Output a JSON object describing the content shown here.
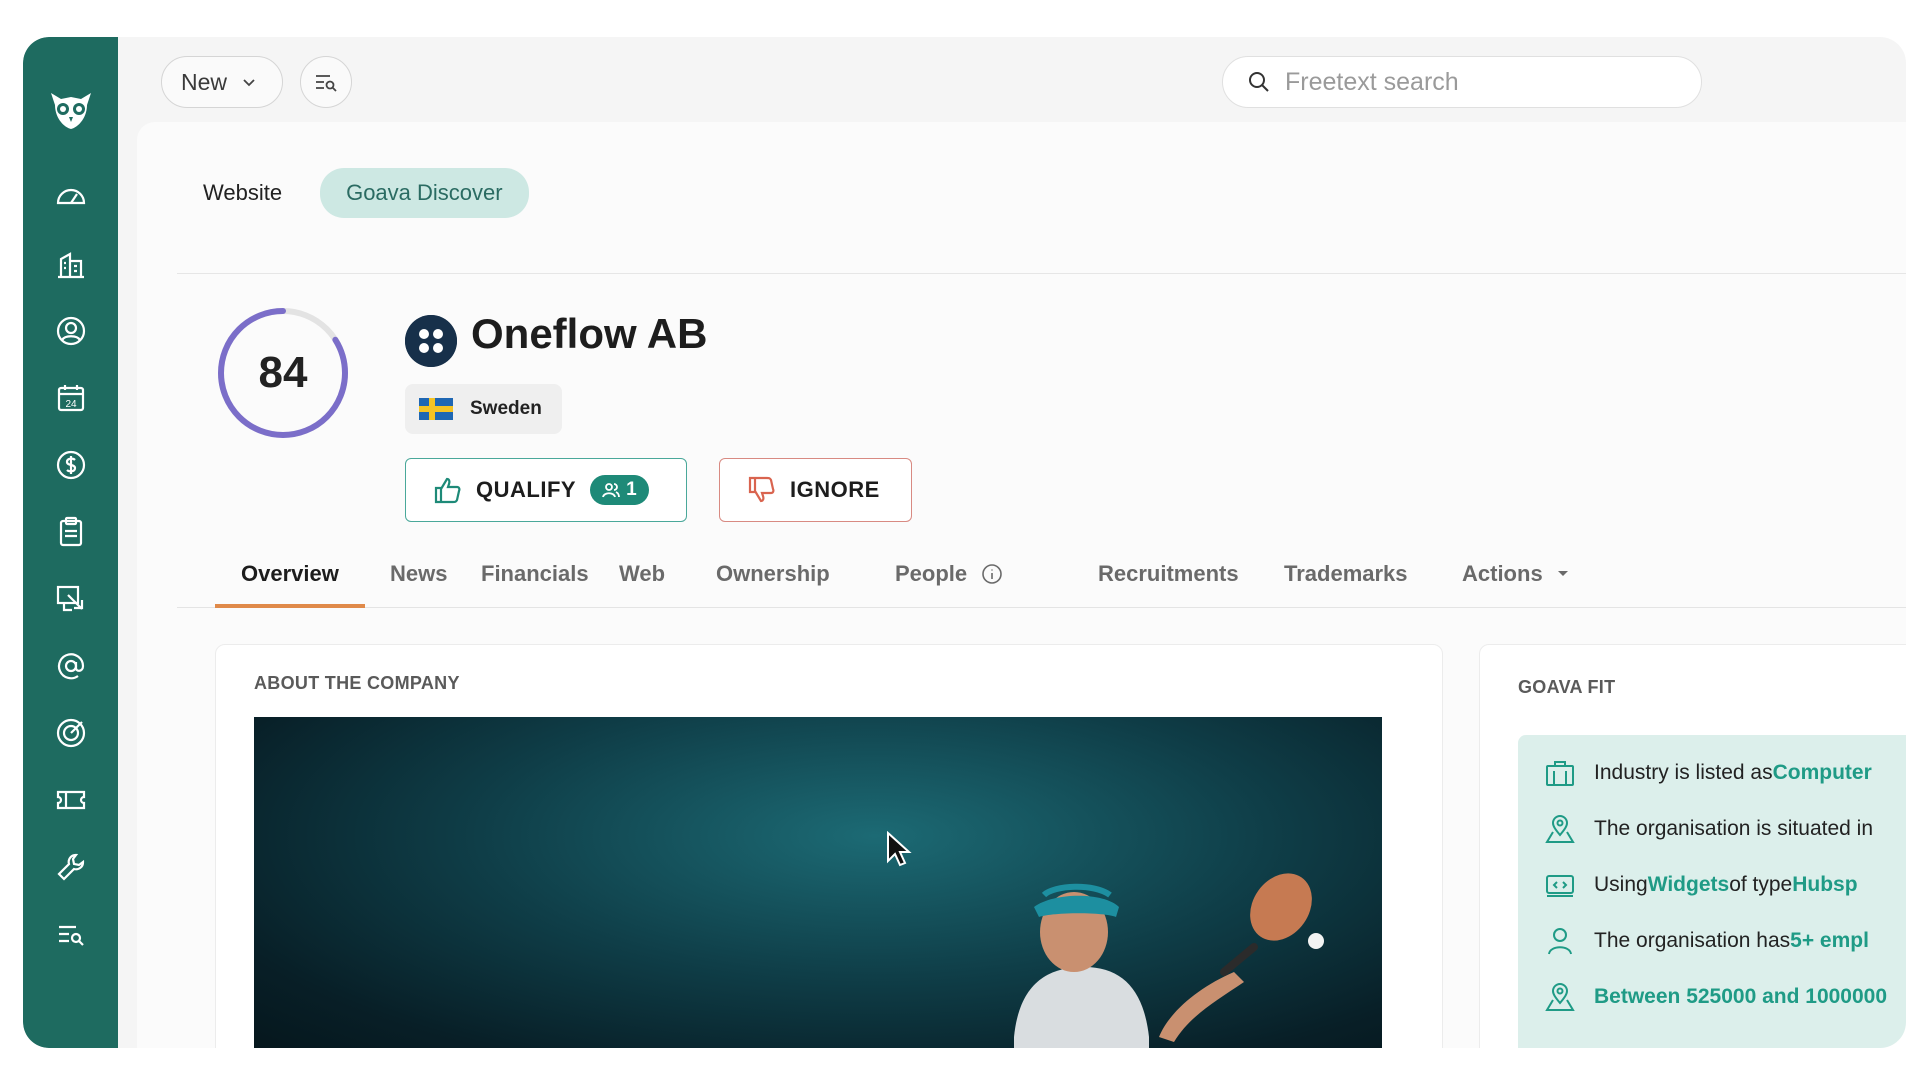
{
  "topbar": {
    "new_label": "New",
    "search_placeholder": "Freetext search"
  },
  "sidebar": {
    "items": [
      "dashboard",
      "companies",
      "contacts",
      "calendar",
      "deals",
      "tasks",
      "documents",
      "email",
      "goals",
      "tickets",
      "tools",
      "filters"
    ]
  },
  "source_tabs": {
    "website": "Website",
    "goava": "Goava Discover"
  },
  "company": {
    "score": "84",
    "score_fraction": 0.84,
    "name": "Oneflow AB",
    "country": "Sweden"
  },
  "actions": {
    "qualify_label": "QUALIFY",
    "qualify_count": "1",
    "ignore_label": "IGNORE"
  },
  "tabs": [
    "Overview",
    "News",
    "Financials",
    "Web",
    "Ownership",
    "People",
    "Recruitments",
    "Trademarks",
    "Actions"
  ],
  "about": {
    "title": "ABOUT THE COMPANY"
  },
  "fit": {
    "title": "GOAVA FIT",
    "rows": [
      {
        "pre": "Industry is listed as ",
        "hl": "Computer"
      },
      {
        "pre": "The organisation is situated in",
        "hl": ""
      },
      {
        "pre": "Using ",
        "hl": "Widgets",
        "mid": " of type ",
        "hl2": "Hubsp"
      },
      {
        "pre": "The organisation has ",
        "hl": "5+ empl"
      },
      {
        "pre": "",
        "hl": "Between 525000 and 1000000"
      }
    ]
  },
  "colors": {
    "sidebar": "#1e6b60",
    "accent": "#1f9b86",
    "score_ring": "#7b6ec9",
    "tab_active": "#e08a4a"
  }
}
